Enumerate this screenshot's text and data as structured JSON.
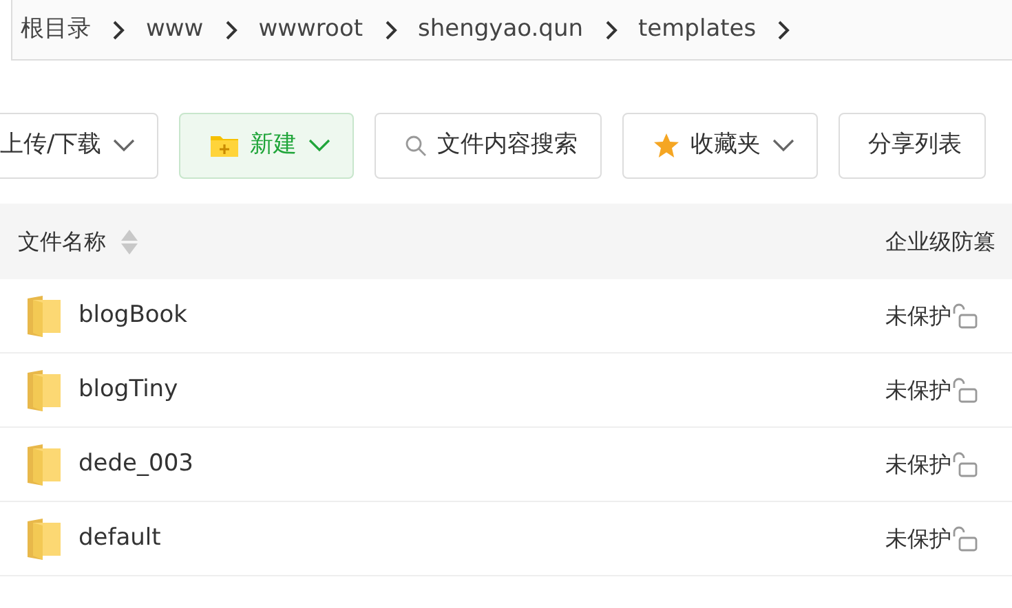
{
  "breadcrumb": [
    {
      "label": "根目录"
    },
    {
      "label": "www"
    },
    {
      "label": "wwwroot"
    },
    {
      "label": "shengyao.qun"
    },
    {
      "label": "templates"
    }
  ],
  "toolbar": [
    {
      "kind": "dropdown",
      "label": "上传/下载"
    },
    {
      "kind": "new",
      "label": "新建"
    },
    {
      "kind": "search",
      "label": "文件内容搜索"
    },
    {
      "kind": "favorites",
      "label": "收藏夹"
    },
    {
      "kind": "plain",
      "label": "分享列表"
    }
  ],
  "table": {
    "columns": [
      "文件名称",
      "企业级防篡"
    ],
    "rows": [
      {
        "name": "blogBook",
        "protection": "未保护"
      },
      {
        "name": "blogTiny",
        "protection": "未保护"
      },
      {
        "name": "dede_003",
        "protection": "未保护"
      },
      {
        "name": "default",
        "protection": "未保护"
      }
    ]
  }
}
